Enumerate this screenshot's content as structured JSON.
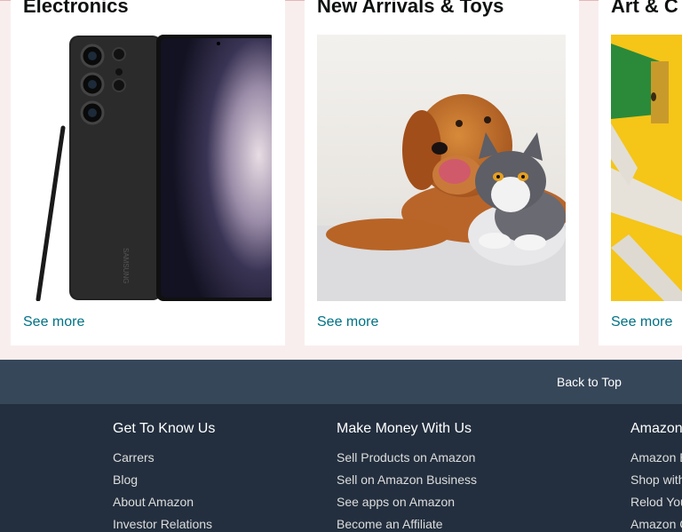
{
  "cards": [
    {
      "title": "Electronics",
      "link": "See more"
    },
    {
      "title": "New Arrivals & Toys",
      "link": "See more"
    },
    {
      "title": "Art & C",
      "link": "See more"
    }
  ],
  "phone_brand": "SAMSUNG",
  "back_to_top": "Back to Top",
  "footer": {
    "columns": [
      {
        "heading": "Get To Know Us",
        "links": [
          "Carrers",
          "Blog",
          "About Amazon",
          "Investor Relations"
        ]
      },
      {
        "heading": "Make Money With Us",
        "links": [
          "Sell Products on Amazon",
          "Sell on Amazon Business",
          "See apps on Amazon",
          "Become an Affiliate"
        ]
      },
      {
        "heading": "Amazon",
        "links": [
          "Amazon B",
          "Shop with",
          "Relod You",
          "Amazon C"
        ]
      }
    ]
  },
  "colors": {
    "link": "#007185",
    "back_to_top_bg": "#37475a",
    "footer_bg": "#232f3e",
    "page_bg": "#f9eeee"
  }
}
